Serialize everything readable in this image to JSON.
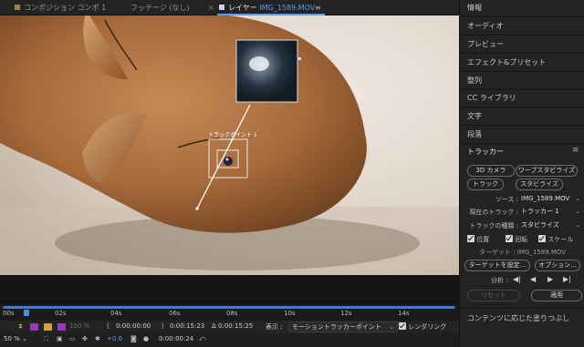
{
  "tabs": {
    "comp": "コンポジション コンポ 1",
    "footage": "フッテージ (なし)",
    "layer_prefix": "レイヤー",
    "layer_name": "IMG_1589.MOV"
  },
  "viewer": {
    "track_point_label": "トラックポイント 1"
  },
  "timeline": {
    "ticks": [
      "00s",
      "02s",
      "04s",
      "06s",
      "08s",
      "10s",
      "12s",
      "14s"
    ]
  },
  "controls": {
    "percent": "100 %",
    "time_start": "0:00:00:00",
    "time_end": "0:00:15:23",
    "duration": "Δ 0:00:15:25",
    "display_label": "表示 :",
    "display_value": "モーショントラッカーポイント",
    "render_label": "レンダリング",
    "zoom": "50 %",
    "exposure": "+0.0",
    "current_time": "0:00:00:24"
  },
  "panel": {
    "items": [
      "情報",
      "オーディオ",
      "プレビュー",
      "エフェクト&プリセット",
      "整列",
      "CC ライブラリ",
      "文字",
      "段落"
    ],
    "tracker_title": "トラッカー",
    "btn_3d": "3D カメラ",
    "btn_warp": "ワープスタビライズ",
    "btn_track": "トラック",
    "btn_stabilize": "スタビライズ",
    "source_label": "ソース :",
    "source_value": "IMG_1589.MOV",
    "current_track_label": "現在のトラック :",
    "current_track_value": "トラッカー 1",
    "track_type_label": "トラックの種類 :",
    "track_type_value": "スタビライズ",
    "cb_position": "位置",
    "cb_rotation": "回転",
    "cb_scale": "スケール",
    "target_label": "ターゲット : IMG_1589.MOV",
    "btn_set_target": "ターゲットを設定...",
    "btn_options": "オプション...",
    "analyze_label": "分析 :",
    "btn_reset": "リセット",
    "btn_apply": "適用",
    "content_aware": "コンテンツに応じた塗りつぶし"
  },
  "colors": {
    "accent": "#5b9bf0",
    "label_orange": "#d9a13b",
    "label_purple": "#9b39b8"
  }
}
